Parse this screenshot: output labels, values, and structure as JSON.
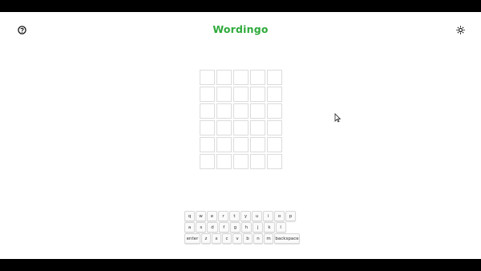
{
  "header": {
    "title": "Wordingo",
    "title_color": "#2eaa3b",
    "help_icon": "help-circle-icon",
    "theme_icon": "sun-icon"
  },
  "board": {
    "rows": 6,
    "cols": 5,
    "tiles": [
      [
        "",
        "",
        "",
        "",
        ""
      ],
      [
        "",
        "",
        "",
        "",
        ""
      ],
      [
        "",
        "",
        "",
        "",
        ""
      ],
      [
        "",
        "",
        "",
        "",
        ""
      ],
      [
        "",
        "",
        "",
        "",
        ""
      ],
      [
        "",
        "",
        "",
        "",
        ""
      ]
    ]
  },
  "keyboard": {
    "row1": [
      "q",
      "w",
      "e",
      "r",
      "t",
      "y",
      "u",
      "i",
      "o",
      "p"
    ],
    "row2": [
      "a",
      "s",
      "d",
      "f",
      "g",
      "h",
      "j",
      "k",
      "l"
    ],
    "row3": [
      "enter",
      "z",
      "x",
      "c",
      "v",
      "b",
      "n",
      "m",
      "backspace"
    ]
  }
}
